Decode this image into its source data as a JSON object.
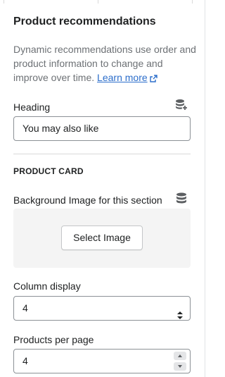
{
  "section": {
    "title": "Product recommendations",
    "description": "Dynamic recommendations use order and product information to change and improve over time.",
    "learn_more": "Learn more"
  },
  "heading_field": {
    "label": "Heading",
    "value": "You may also like"
  },
  "product_card": {
    "subheading": "PRODUCT CARD"
  },
  "background_image": {
    "label": "Background Image for this section",
    "button": "Select Image"
  },
  "column_display": {
    "label": "Column display",
    "value": "4"
  },
  "products_per_page": {
    "label": "Products per page",
    "value": "4"
  },
  "icons": [
    "external-link-icon",
    "dynamic-source-icon",
    "database-icon",
    "select-arrows-icon",
    "stepper-up-icon",
    "stepper-down-icon"
  ],
  "colors": {
    "link": "#2c6ecb",
    "muted_text": "#6d7175",
    "border": "#8c9196"
  }
}
